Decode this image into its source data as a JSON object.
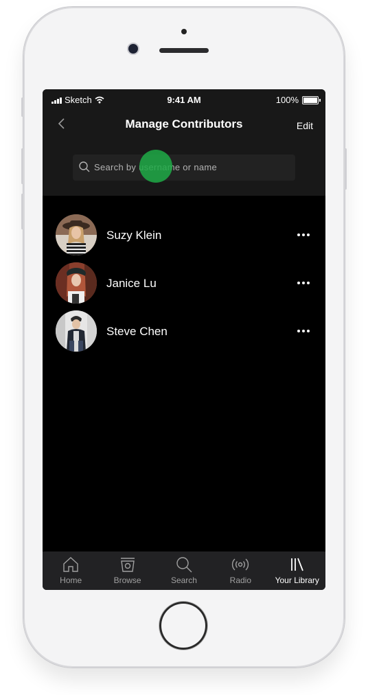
{
  "status_bar": {
    "carrier": "Sketch",
    "time": "9:41 AM",
    "battery": "100%"
  },
  "nav": {
    "title": "Manage Contributors",
    "edit_label": "Edit"
  },
  "search": {
    "placeholder": "Search by username or name"
  },
  "contributors": [
    {
      "name": "Suzy Klein"
    },
    {
      "name": "Janice Lu"
    },
    {
      "name": "Steve Chen"
    }
  ],
  "tabs": [
    {
      "label": "Home",
      "icon": "home-icon",
      "active": false
    },
    {
      "label": "Browse",
      "icon": "browse-icon",
      "active": false
    },
    {
      "label": "Search",
      "icon": "search-icon",
      "active": false
    },
    {
      "label": "Radio",
      "icon": "radio-icon",
      "active": false
    },
    {
      "label": "Your Library",
      "icon": "library-icon",
      "active": true
    }
  ],
  "colors": {
    "screen_bg": "#000000",
    "header_bg": "#181818",
    "search_bg": "#222222",
    "touch_indicator": "#1eaa46",
    "tab_inactive": "#a0a0a0",
    "tab_active": "#ffffff"
  }
}
